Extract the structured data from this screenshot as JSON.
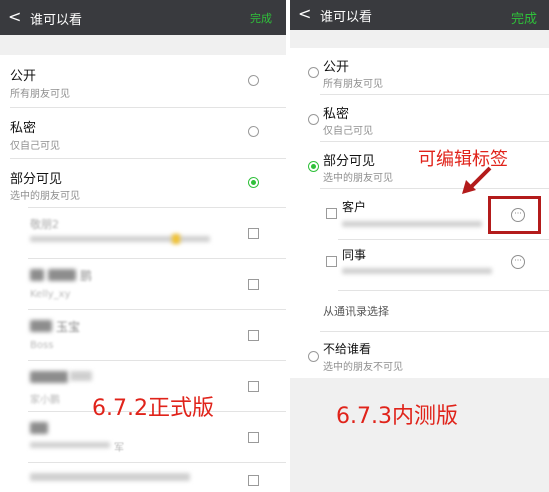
{
  "left": {
    "header": {
      "back": "<",
      "title": "谁可以看",
      "done": "完成"
    },
    "options": [
      {
        "title": "公开",
        "subtitle": "所有朋友可见"
      },
      {
        "title": "私密",
        "subtitle": "仅自己可见"
      },
      {
        "title": "部分可见",
        "subtitle": "选中的朋友可见"
      }
    ],
    "group_fragments": [
      "敬朋2",
      "鹏",
      "Kelly_xy",
      "玉宝",
      "Boss",
      "家小鹏",
      "军"
    ],
    "version_label": "6.7.2正式版"
  },
  "right": {
    "header": {
      "back": "<",
      "title": "谁可以看",
      "done": "完成"
    },
    "options": [
      {
        "title": "公开",
        "subtitle": "所有朋友可见"
      },
      {
        "title": "私密",
        "subtitle": "仅自己可见"
      },
      {
        "title": "部分可见",
        "subtitle": "选中的朋友可见"
      }
    ],
    "groups": [
      {
        "name": "客户"
      },
      {
        "name": "同事"
      }
    ],
    "contacts_link": "从通讯录选择",
    "not_show": {
      "title": "不给谁看",
      "subtitle": "选中的朋友不可见"
    },
    "annotation": "可编辑标签",
    "version_label": "6.7.3内测版",
    "annotation_color": "#e0231a"
  }
}
